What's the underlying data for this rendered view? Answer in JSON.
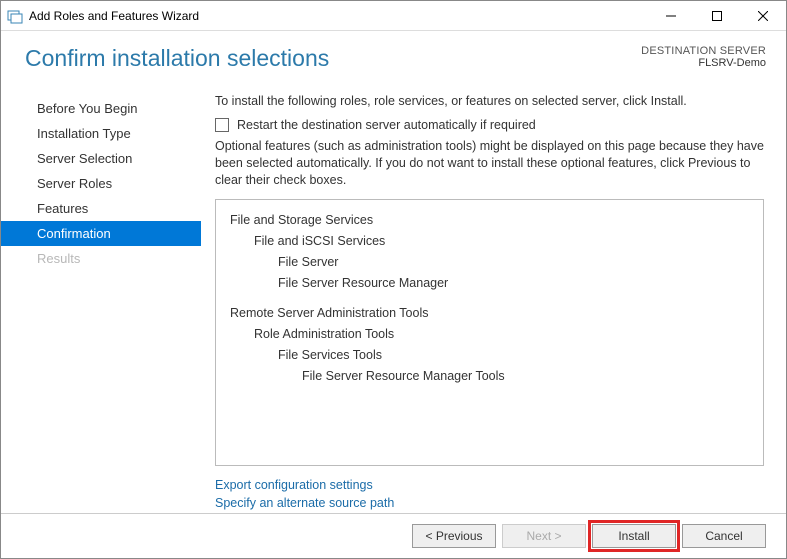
{
  "window": {
    "title": "Add Roles and Features Wizard"
  },
  "header": {
    "page_title": "Confirm installation selections",
    "dest_label": "DESTINATION SERVER",
    "dest_name": "FLSRV-Demo"
  },
  "sidebar": {
    "items": [
      {
        "label": "Before You Begin"
      },
      {
        "label": "Installation Type"
      },
      {
        "label": "Server Selection"
      },
      {
        "label": "Server Roles"
      },
      {
        "label": "Features"
      },
      {
        "label": "Confirmation"
      },
      {
        "label": "Results"
      }
    ]
  },
  "main": {
    "intro": "To install the following roles, role services, or features on selected server, click Install.",
    "restart_label": "Restart the destination server automatically if required",
    "optional_text": "Optional features (such as administration tools) might be displayed on this page because they have been selected automatically. If you do not want to install these optional features, click Previous to clear their check boxes.",
    "features": {
      "g1": "File and Storage Services",
      "g1a": "File and iSCSI Services",
      "g1a1": "File Server",
      "g1a2": "File Server Resource Manager",
      "g2": "Remote Server Administration Tools",
      "g2a": "Role Administration Tools",
      "g2a1": "File Services Tools",
      "g2a1a": "File Server Resource Manager Tools"
    },
    "links": {
      "export": "Export configuration settings",
      "altpath": "Specify an alternate source path"
    }
  },
  "footer": {
    "previous": "< Previous",
    "next": "Next >",
    "install": "Install",
    "cancel": "Cancel"
  }
}
